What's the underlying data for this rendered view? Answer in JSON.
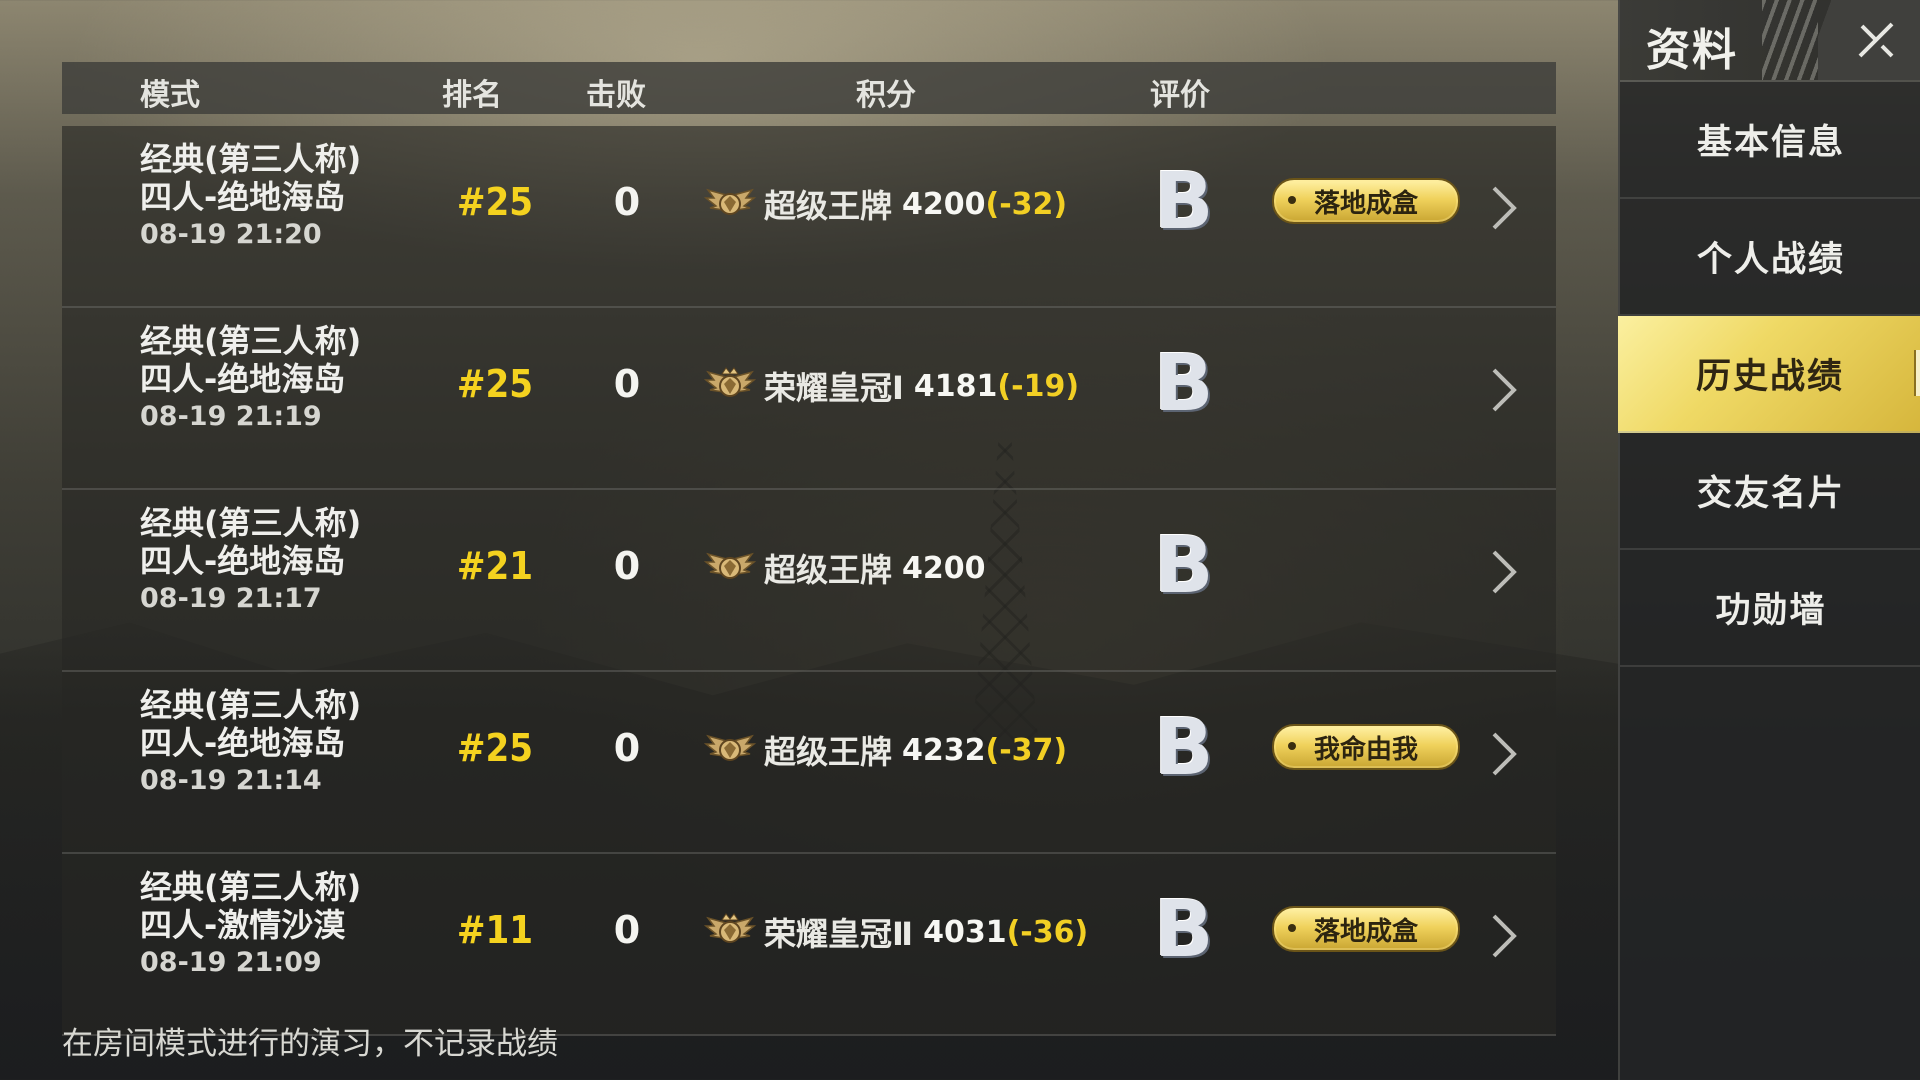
{
  "table": {
    "headers": {
      "mode": "模式",
      "rank": "排名",
      "kills": "击败",
      "score": "积分",
      "rating": "评价"
    },
    "rows": [
      {
        "mode_line1": "经典(第三人称)",
        "mode_line2": "四人-绝地海岛",
        "time": "08-19 21:20",
        "rank": "#25",
        "kills": "0",
        "tier": "超级王牌",
        "tier_emblem": "ace-emblem-icon",
        "points": "4200",
        "delta": "(-32)",
        "rating": "B",
        "badge": "落地成盒"
      },
      {
        "mode_line1": "经典(第三人称)",
        "mode_line2": "四人-绝地海岛",
        "time": "08-19 21:19",
        "rank": "#25",
        "kills": "0",
        "tier": "荣耀皇冠Ⅰ",
        "tier_emblem": "crown-emblem-icon",
        "points": "4181",
        "delta": "(-19)",
        "rating": "B",
        "badge": ""
      },
      {
        "mode_line1": "经典(第三人称)",
        "mode_line2": "四人-绝地海岛",
        "time": "08-19 21:17",
        "rank": "#21",
        "kills": "0",
        "tier": "超级王牌",
        "tier_emblem": "ace-emblem-icon",
        "points": "4200",
        "delta": "",
        "rating": "B",
        "badge": ""
      },
      {
        "mode_line1": "经典(第三人称)",
        "mode_line2": "四人-绝地海岛",
        "time": "08-19 21:14",
        "rank": "#25",
        "kills": "0",
        "tier": "超级王牌",
        "tier_emblem": "ace-emblem-icon",
        "points": "4232",
        "delta": "(-37)",
        "rating": "B",
        "badge": "我命由我"
      },
      {
        "mode_line1": "经典(第三人称)",
        "mode_line2": "四人-激情沙漠",
        "time": "08-19 21:09",
        "rank": "#11",
        "kills": "0",
        "tier": "荣耀皇冠Ⅱ",
        "tier_emblem": "crown-emblem-icon",
        "points": "4031",
        "delta": "(-36)",
        "rating": "B",
        "badge": "落地成盒"
      }
    ]
  },
  "footer_note": "在房间模式进行的演习，不记录战绩",
  "sidebar": {
    "title": "资料",
    "close_icon": "close-icon",
    "items": [
      {
        "label": "基本信息",
        "active": false
      },
      {
        "label": "个人战绩",
        "active": false
      },
      {
        "label": "历史战绩",
        "active": true
      },
      {
        "label": "交友名片",
        "active": false
      },
      {
        "label": "功勋墙",
        "active": false
      }
    ]
  },
  "colors": {
    "rank_yellow": "#f4d21f",
    "delta_yellow": "#f2cf24",
    "active_nav": "#efd965",
    "badge_gold": "#f0d25c"
  }
}
